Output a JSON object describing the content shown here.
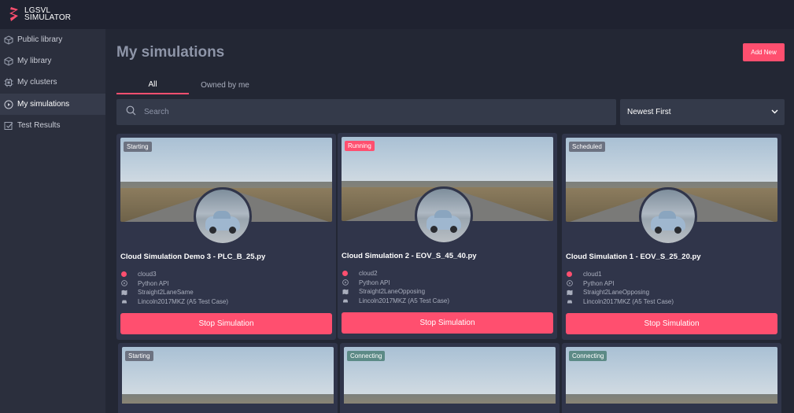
{
  "brand": {
    "line1": "LGSVL",
    "line2": "SIMULATOR",
    "accent": "#ff4f6f"
  },
  "sidebar": {
    "items": [
      {
        "label": "Public library",
        "icon": "cube-outline-icon"
      },
      {
        "label": "My library",
        "icon": "cube-icon"
      },
      {
        "label": "My clusters",
        "icon": "chip-icon"
      },
      {
        "label": "My simulations",
        "icon": "play-circle-icon",
        "active": true
      },
      {
        "label": "Test Results",
        "icon": "checkbox-icon"
      }
    ]
  },
  "main": {
    "title": "My simulations",
    "add_new_label": "Add New",
    "tabs": [
      {
        "label": "All",
        "active": true
      },
      {
        "label": "Owned by me"
      }
    ],
    "search": {
      "placeholder": "Search",
      "value": ""
    },
    "sort": {
      "selected": "Newest First"
    }
  },
  "cards": [
    {
      "status": "Starting",
      "title": "Cloud Simulation Demo 3 - PLC_B_25.py",
      "cluster": "cloud3",
      "api": "Python API",
      "map": "Straight2LaneSame",
      "vehicle": "Lincoln2017MKZ (A5 Test Case)",
      "action": "Stop Simulation"
    },
    {
      "status": "Running",
      "title": "Cloud Simulation 2 - EOV_S_45_40.py",
      "cluster": "cloud2",
      "api": "Python API",
      "map": "Straight2LaneOpposing",
      "vehicle": "Lincoln2017MKZ (A5 Test Case)",
      "action": "Stop Simulation"
    },
    {
      "status": "Scheduled",
      "title": "Cloud Simulation 1 - EOV_S_25_20.py",
      "cluster": "cloud1",
      "api": "Python API",
      "map": "Straight2LaneOpposing",
      "vehicle": "Lincoln2017MKZ (A5 Test Case)",
      "action": "Stop Simulation"
    },
    {
      "status": "Starting"
    },
    {
      "status": "Connecting"
    },
    {
      "status": "Connecting"
    }
  ]
}
